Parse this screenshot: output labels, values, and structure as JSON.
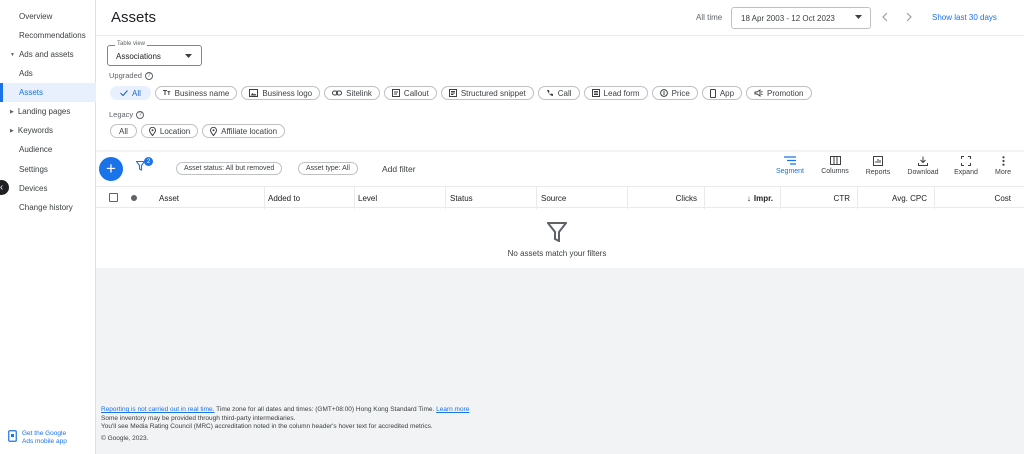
{
  "sidebar": {
    "items": [
      {
        "label": "Overview"
      },
      {
        "label": "Recommendations"
      },
      {
        "label": "Ads and assets"
      },
      {
        "label": "Ads"
      },
      {
        "label": "Assets"
      },
      {
        "label": "Landing pages"
      },
      {
        "label": "Keywords"
      },
      {
        "label": "Audience"
      },
      {
        "label": "Settings"
      },
      {
        "label": "Devices"
      },
      {
        "label": "Change history"
      }
    ],
    "mobile_app_line1": "Get the Google",
    "mobile_app_line2": "Ads mobile app"
  },
  "header": {
    "title": "Assets",
    "all_time": "All time",
    "date_range": "18 Apr 2003 - 12 Oct 2023",
    "show_last": "Show last 30 days"
  },
  "filters": {
    "table_view_label": "Table view",
    "table_view_value": "Associations",
    "upgraded_label": "Upgraded",
    "upgraded_chips": [
      "All",
      "Business name",
      "Business logo",
      "Sitelink",
      "Callout",
      "Structured snippet",
      "Call",
      "Lead form",
      "Price",
      "App",
      "Promotion"
    ],
    "legacy_label": "Legacy",
    "legacy_chips": [
      "All",
      "Location",
      "Affiliate location"
    ]
  },
  "toolbar": {
    "filter_count": "2",
    "asset_status_chip": "Asset status: All but removed",
    "asset_type_chip": "Asset type: All",
    "add_filter": "Add filter",
    "tools": [
      "Segment",
      "Columns",
      "Reports",
      "Download",
      "Expand",
      "More"
    ]
  },
  "table": {
    "columns": [
      "Asset",
      "Added to",
      "Level",
      "Status",
      "Source",
      "Clicks",
      "Impr.",
      "CTR",
      "Avg. CPC",
      "Cost"
    ],
    "empty_message": "No assets match your filters"
  },
  "footer": {
    "line1_link": "Reporting is not carried out in real time.",
    "line1_text": " Time zone for all dates and times: (GMT+08:00) Hong Kong Standard Time. ",
    "line1_link2": "Learn more",
    "line2": "Some inventory may be provided through third-party intermediaries.",
    "line3": "You'll see Media Rating Council (MRC) accreditation noted in the column header's hover text for accredited metrics.",
    "line4": "© Google, 2023."
  },
  "colors": {
    "accent": "#1a73e8",
    "selected_chip_bg": "#e8f0fe",
    "background": "#f1f3f4"
  }
}
